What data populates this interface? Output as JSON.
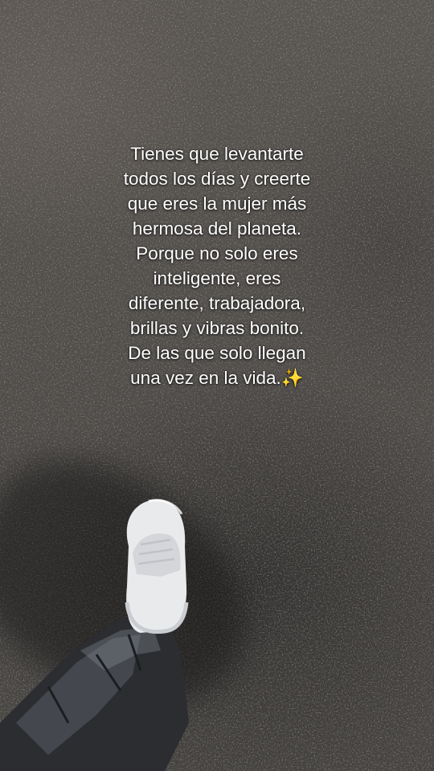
{
  "quote": {
    "lines": [
      "Tienes que levantarte",
      "todos los días y creerte",
      "que eres la mujer más",
      "hermosa del planeta.",
      "Porque no solo eres",
      "inteligente, eres",
      "diferente, trabajadora,",
      "brillas y vibras bonito.",
      "De las que solo llegan",
      "una vez en la vida."
    ],
    "sparkle_emoji": "✨",
    "text_color": "#ffffff",
    "sparkle_color": "#ffd84a"
  },
  "background": {
    "scene": "asphalt-ground",
    "subject": "white-sneaker-and-jeans",
    "ground_color": "#4a4744"
  }
}
